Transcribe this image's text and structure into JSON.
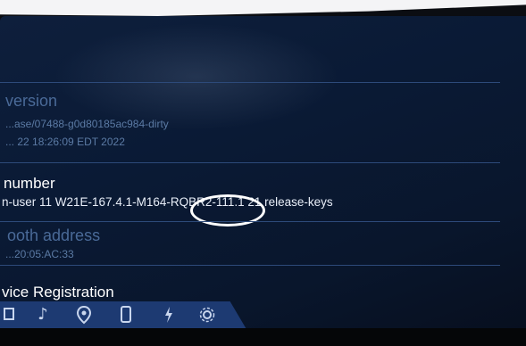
{
  "settings": {
    "version": {
      "title": "version",
      "line1": "...ase/07488-g0d80185ac984-dirty",
      "line2": "... 22 18:26:09 EDT 2022"
    },
    "build_number": {
      "title": "number",
      "value": "n-user 11 W21E-167.4.1-M164-RQBR2-111.1 21 release-keys"
    },
    "bluetooth": {
      "title": "ooth address",
      "value": "...20:05:AC:33"
    },
    "registration": {
      "title": "vice Registration"
    }
  },
  "nav": {
    "icons": [
      "home-icon",
      "music-icon",
      "location-icon",
      "phone-icon",
      "energy-icon",
      "settings-icon"
    ]
  },
  "colors": {
    "background": "#0a1a35",
    "accent": "#1d3a72",
    "text": "#ffffff",
    "dim_text": "#5b7aa4"
  }
}
